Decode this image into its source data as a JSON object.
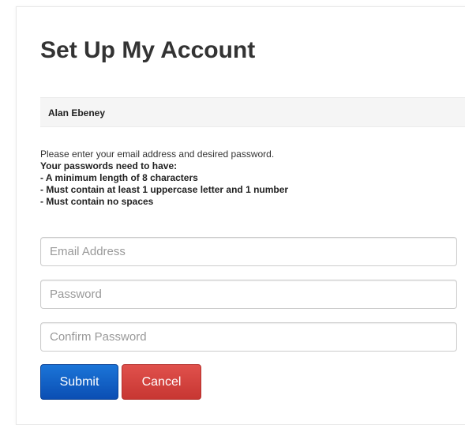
{
  "title": "Set Up My Account",
  "user_name": "Alan Ebeney",
  "instructions": {
    "intro": "Please enter your email address and desired password.",
    "heading": "Your passwords need to have:",
    "rules": [
      "- A minimum length of 8 characters",
      "- Must contain at least 1 uppercase letter and 1 number",
      "- Must contain no spaces"
    ]
  },
  "fields": {
    "email": {
      "value": "",
      "placeholder": "Email Address"
    },
    "password": {
      "value": "",
      "placeholder": "Password"
    },
    "confirm": {
      "value": "",
      "placeholder": "Confirm Password"
    }
  },
  "buttons": {
    "submit_label": "Submit",
    "cancel_label": "Cancel"
  },
  "colors": {
    "submit": "#0b5ed0",
    "cancel": "#d9443f"
  }
}
